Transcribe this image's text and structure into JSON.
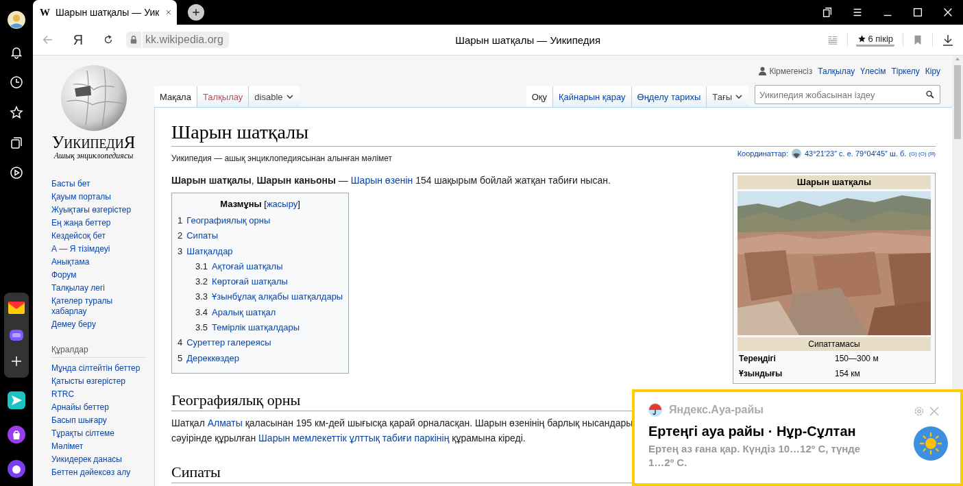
{
  "browser_tab": {
    "favicon": "W",
    "title": "Шарын шатқалы — Уик"
  },
  "address_bar": {
    "yandex_key": "Я",
    "domain": "kk.wikipedia.org",
    "page_title": "Шарын шатқалы — Уикипедия",
    "reviews": "6 пікір"
  },
  "wiki": {
    "logo": {
      "wordmark": "УикипедиЯ",
      "tagline": "Ашық энциклопедиясы"
    },
    "nav": [
      "Басты бет",
      "Қауым порталы",
      "Жуықтағы өзгерістер",
      "Ең жаңа беттер",
      "Кездейсоқ бет",
      "А — Я тізімдеуі",
      "Анықтама",
      "Форум",
      "Талқылау легі",
      "Қателер туралы хабарлау",
      "Демеу беру"
    ],
    "tools_heading": "Құралдар",
    "tools": [
      "Мұнда сілтейтін беттер",
      "Қатысты өзгерістер",
      "RTRC",
      "Арнайы беттер",
      "Басып шығару",
      "Тұрақты сілтеме",
      "Мәлімет",
      "Уикидерек данасы",
      "Беттен дәйексөз алу"
    ],
    "personal": {
      "user": "Кірмегенсіз",
      "links": [
        "Талқылау",
        "Үлесім",
        "Тіркелу",
        "Кіру"
      ]
    },
    "left_tabs": [
      {
        "label": "Мақала",
        "selected": true,
        "kind": "tab"
      },
      {
        "label": "Талқылау",
        "selected": false,
        "kind": "redlink"
      },
      {
        "label": "disable",
        "selected": false,
        "kind": "menu"
      }
    ],
    "right_tabs": [
      {
        "label": "Оқу",
        "selected": true,
        "kind": "tab"
      },
      {
        "label": "Қайнарын қарау",
        "selected": false,
        "kind": "tab"
      },
      {
        "label": "Өңделу тарихы",
        "selected": false,
        "kind": "tab"
      },
      {
        "label": "Тағы",
        "selected": false,
        "kind": "menu"
      }
    ],
    "search": {
      "placeholder": "Уикипедия жобасынан іздеу"
    },
    "title": "Шарын шатқалы",
    "tagline": "Уикипедия — ашық энциклопедиясынан алынған мәлімет",
    "coordinates": {
      "label": "Координаттар:",
      "value": "43°21′23″ с. е. 79°04′45″ ш. б.",
      "sources": "(G) (O) (Я)"
    },
    "intro": [
      {
        "kind": "bold",
        "text": "Шарын шатқалы"
      },
      {
        "kind": "plain",
        "text": ", "
      },
      {
        "kind": "bold",
        "text": "Шарын каньоны"
      },
      {
        "kind": "plain",
        "text": " — "
      },
      {
        "kind": "link",
        "text": "Шарын өзенін"
      },
      {
        "kind": "plain",
        "text": " 154 шақырым бойлай жатқан табиғи нысан."
      }
    ],
    "toc": {
      "title": "Мазмұны",
      "bracket_open": "[",
      "toggle": "жасыру",
      "bracket_close": "]",
      "items": [
        {
          "number": "1",
          "label": "Географиялық орны"
        },
        {
          "number": "2",
          "label": "Сипаты"
        },
        {
          "number": "3",
          "label": "Шатқалдар",
          "children": [
            {
              "number": "3.1",
              "label": "Ақтоғай шатқалы"
            },
            {
              "number": "3.2",
              "label": "Көртоғай шатқалы"
            },
            {
              "number": "3.3",
              "label": "Ұзынбұлақ алқабы шатқалдары"
            },
            {
              "number": "3.4",
              "label": "Аралық шатқал"
            },
            {
              "number": "3.5",
              "label": "Темірлік шатқалдары"
            }
          ]
        },
        {
          "number": "4",
          "label": "Суреттер галереясы"
        },
        {
          "number": "5",
          "label": "Дереккөздер"
        }
      ]
    },
    "sections": [
      {
        "heading": "Географиялық орны",
        "lines": [
          [
            {
              "kind": "plain",
              "text": "Шатқал "
            },
            {
              "kind": "link",
              "text": "Алматы"
            },
            {
              "kind": "plain",
              "text": " қаласынан 195 км-дей шығысқа қарай орналасқан. Шарын өзенінің барлық нысандары"
            }
          ],
          [
            {
              "kind": "plain",
              "text": "сәуірінде құрылған "
            },
            {
              "kind": "link",
              "text": "Шарын мемлекеттік ұлттық табиғи паркінің"
            },
            {
              "kind": "plain",
              "text": " құрамына кіреді."
            }
          ]
        ]
      },
      {
        "heading": "Сипаты"
      }
    ],
    "infobox": {
      "title": "Шарын шатқалы",
      "section": "Сипаттамасы",
      "rows": [
        {
          "label": "Тереңдігі",
          "value": "150—300 м"
        },
        {
          "label": "Ұзындығы",
          "value": "154 км"
        }
      ]
    }
  },
  "notification": {
    "app": "Яндекс.Ауа-райы",
    "title": "Ертеңгі ауа райы · Нұр-Сұлтан",
    "text": "Ертең аз ғана қар. Күндіз 10…12º C, түнде 1…2º C."
  }
}
